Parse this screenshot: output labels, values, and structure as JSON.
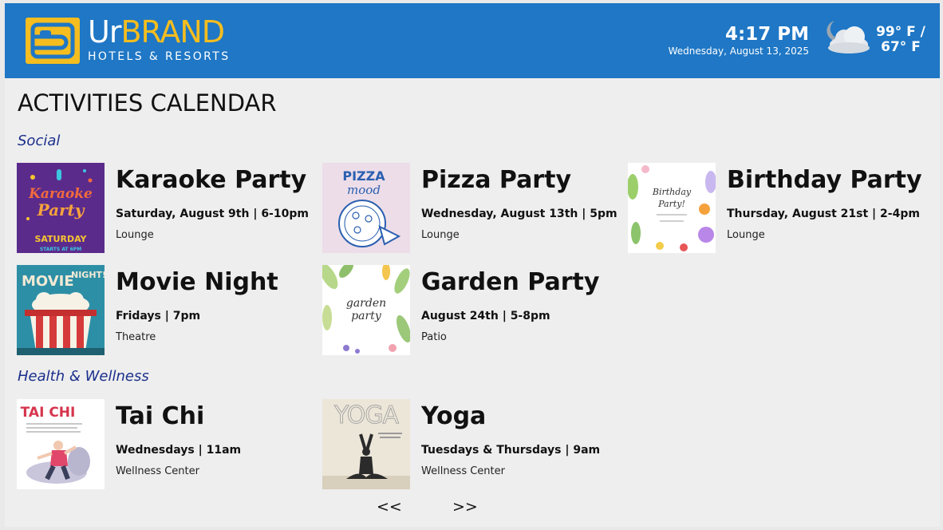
{
  "header": {
    "brand_ur": "Ur",
    "brand_name": "BRAND",
    "brand_sub": "HOTELS & RESORTS",
    "time": "4:17 PM",
    "date": "Wednesday, August 13, 2025",
    "temp_high": "99° F /",
    "temp_low": "67° F",
    "weather_icon": "night-cloudy-icon",
    "logo_icon": "hotel-bed-logo-icon",
    "colors": {
      "bar": "#1f77c5",
      "accent": "#f5bd1f"
    }
  },
  "page_title": "ACTIVITIES CALENDAR",
  "sections": [
    {
      "title": "Social",
      "events": [
        {
          "title": "Karaoke Party",
          "when": "Saturday, August 9th | 6-10pm",
          "where": "Lounge",
          "thumb": "karaoke-poster",
          "thumb_text": [
            "Karaoke",
            "Party",
            "SATURDAY",
            "STARTS AT 6PM"
          ]
        },
        {
          "title": "Pizza Party",
          "when": "Wednesday, August 13th | 5pm",
          "where": "Lounge",
          "thumb": "pizza-poster",
          "thumb_text": [
            "PIZZA",
            "mood"
          ]
        },
        {
          "title": "Birthday Party",
          "when": "Thursday, August 21st | 2-4pm",
          "where": "Lounge",
          "thumb": "birthday-poster",
          "thumb_text": [
            "Birthday",
            "Party!"
          ]
        },
        {
          "title": "Movie Night",
          "when": "Fridays | 7pm",
          "where": "Theatre",
          "thumb": "movie-poster",
          "thumb_text": [
            "MOVIE",
            "NIGHT!"
          ]
        },
        {
          "title": "Garden Party",
          "when": "August 24th | 5-8pm",
          "where": "Patio",
          "thumb": "garden-poster",
          "thumb_text": [
            "garden",
            "party"
          ]
        }
      ]
    },
    {
      "title": "Health & Wellness",
      "events": [
        {
          "title": "Tai Chi",
          "when": "Wednesdays | 11am",
          "where": "Wellness Center",
          "thumb": "taichi-poster",
          "thumb_text": [
            "TAI CHI"
          ]
        },
        {
          "title": "Yoga",
          "when": "Tuesdays & Thursdays | 9am",
          "where": "Wellness Center",
          "thumb": "yoga-poster",
          "thumb_text": [
            "YOGA"
          ]
        }
      ]
    }
  ],
  "pager": {
    "prev": "<<",
    "next": ">>"
  }
}
